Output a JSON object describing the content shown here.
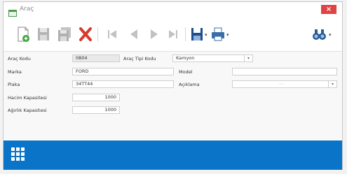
{
  "window": {
    "title": "Araç",
    "close_glyph": "×"
  },
  "toolbar": {
    "items": [
      {
        "icon": "new-document-icon"
      },
      {
        "icon": "save-icon"
      },
      {
        "icon": "save-all-icon"
      },
      {
        "icon": "delete-icon"
      },
      {
        "icon": "first-record-icon"
      },
      {
        "icon": "previous-record-icon"
      },
      {
        "icon": "next-record-icon"
      },
      {
        "icon": "last-record-icon"
      },
      {
        "icon": "export-icon"
      },
      {
        "icon": "print-icon"
      },
      {
        "icon": "search-binoculars-icon"
      }
    ],
    "dropdown_glyph": "▾"
  },
  "form": {
    "arac_kodu": {
      "label": "Araç Kodu",
      "value": "0804"
    },
    "arac_tipi": {
      "label": "Araç Tipi Kodu",
      "value": "Kamyon"
    },
    "marka": {
      "label": "Marka",
      "value": "FORD"
    },
    "model": {
      "label": "Model",
      "value": ""
    },
    "plaka": {
      "label": "Plaka",
      "value": "34TT44"
    },
    "aciklama": {
      "label": "Açıklama",
      "value": ""
    },
    "hacim": {
      "label": "Hacim Kapasitesi",
      "value": "1000"
    },
    "agirlik": {
      "label": "Ağırlık Kapasitesi",
      "value": "1000"
    }
  },
  "colors": {
    "accent": "#0a74c9",
    "close": "#e04343"
  }
}
